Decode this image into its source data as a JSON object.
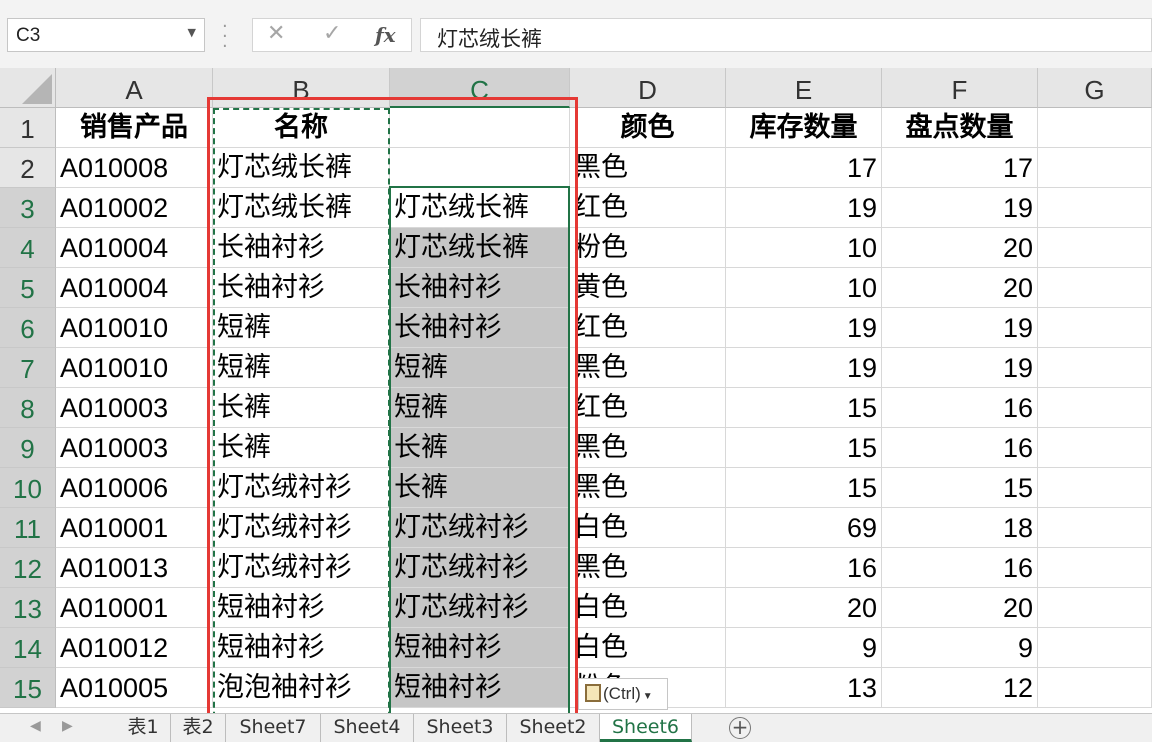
{
  "formula_bar": {
    "name_box": "C3",
    "fx_label": "fx",
    "formula_value": "灯芯绒长裤"
  },
  "columns": [
    "A",
    "B",
    "C",
    "D",
    "E",
    "F",
    "G"
  ],
  "rows": [
    "1",
    "2",
    "3",
    "4",
    "5",
    "6",
    "7",
    "8",
    "9",
    "10",
    "11",
    "12",
    "13",
    "14",
    "15"
  ],
  "headers": {
    "A": "销售产品",
    "B": "名称",
    "C": "",
    "D": "颜色",
    "E": "库存数量",
    "F": "盘点数量"
  },
  "data": [
    {
      "A": "A010008",
      "B": "灯芯绒长裤",
      "C": "",
      "D": "黑色",
      "E": "17",
      "F": "17"
    },
    {
      "A": "A010002",
      "B": "灯芯绒长裤",
      "C": "灯芯绒长裤",
      "D": "红色",
      "E": "19",
      "F": "19"
    },
    {
      "A": "A010004",
      "B": "长袖衬衫",
      "C": "灯芯绒长裤",
      "D": "粉色",
      "E": "10",
      "F": "20"
    },
    {
      "A": "A010004",
      "B": "长袖衬衫",
      "C": "长袖衬衫",
      "D": "黄色",
      "E": "10",
      "F": "20"
    },
    {
      "A": "A010010",
      "B": "短裤",
      "C": "长袖衬衫",
      "D": "红色",
      "E": "19",
      "F": "19"
    },
    {
      "A": "A010010",
      "B": "短裤",
      "C": "短裤",
      "D": "黑色",
      "E": "19",
      "F": "19"
    },
    {
      "A": "A010003",
      "B": "长裤",
      "C": "短裤",
      "D": "红色",
      "E": "15",
      "F": "16"
    },
    {
      "A": "A010003",
      "B": "长裤",
      "C": "长裤",
      "D": "黑色",
      "E": "15",
      "F": "16"
    },
    {
      "A": "A010006",
      "B": "灯芯绒衬衫",
      "C": "长裤",
      "D": "黑色",
      "E": "15",
      "F": "15"
    },
    {
      "A": "A010001",
      "B": "灯芯绒衬衫",
      "C": "灯芯绒衬衫",
      "D": "白色",
      "E": "69",
      "F": "18"
    },
    {
      "A": "A010013",
      "B": "灯芯绒衬衫",
      "C": "灯芯绒衬衫",
      "D": "黑色",
      "E": "16",
      "F": "16"
    },
    {
      "A": "A010001",
      "B": "短袖衬衫",
      "C": "灯芯绒衬衫",
      "D": "白色",
      "E": "20",
      "F": "20"
    },
    {
      "A": "A010012",
      "B": "短袖衬衫",
      "C": "短袖衬衫",
      "D": "白色",
      "E": "9",
      "F": "9"
    },
    {
      "A": "A010005",
      "B": "泡泡袖衬衫",
      "C": "短袖衬衫",
      "D": "粉色",
      "E": "13",
      "F": "12"
    }
  ],
  "paste_options": {
    "label": "(Ctrl)"
  },
  "sheet_tabs": [
    "表1",
    "表2",
    "Sheet7",
    "Sheet4",
    "Sheet3",
    "Sheet2",
    "Sheet6"
  ],
  "active_sheet": "Sheet6",
  "colors": {
    "accent": "#217346",
    "highlight": "#e53935",
    "selection": "#c6c6c6"
  }
}
